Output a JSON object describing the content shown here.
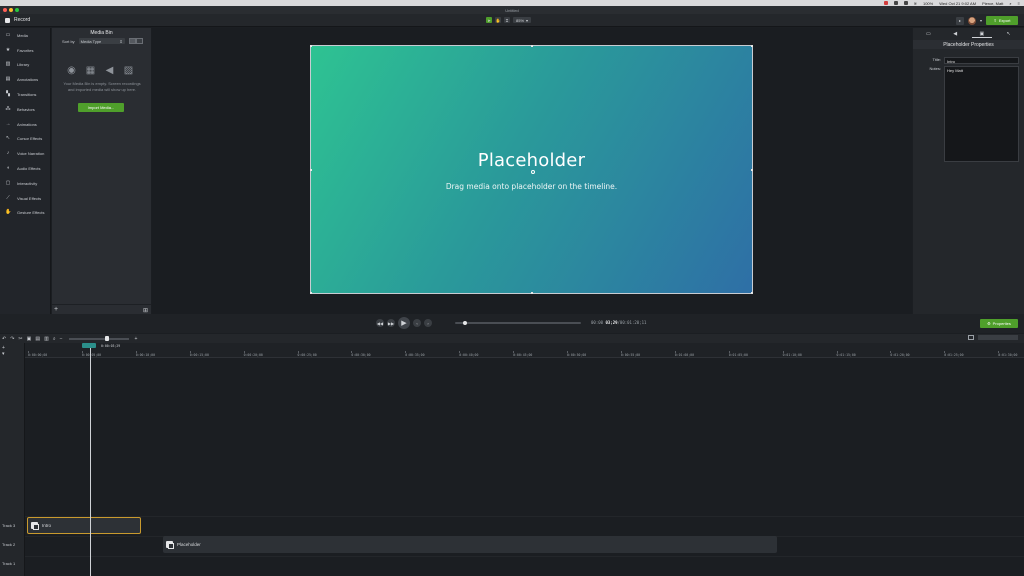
{
  "menubar": {
    "battery": "100%",
    "datetime": "Wed Oct 21  9:02 AM",
    "user": "Pierce, Matt"
  },
  "window": {
    "title": "Untitled"
  },
  "toolbar": {
    "record_label": "Record",
    "zoom_value": "85%",
    "export_label": "Export"
  },
  "sidebar": {
    "items": [
      {
        "label": "Media",
        "icon": "media-icon"
      },
      {
        "label": "Favorites",
        "icon": "star-icon"
      },
      {
        "label": "Library",
        "icon": "library-icon"
      },
      {
        "label": "Annotations",
        "icon": "annotations-icon"
      },
      {
        "label": "Transitions",
        "icon": "transitions-icon"
      },
      {
        "label": "Behaviors",
        "icon": "behaviors-icon"
      },
      {
        "label": "Animations",
        "icon": "animations-icon"
      },
      {
        "label": "Cursor Effects",
        "icon": "cursor-icon"
      },
      {
        "label": "Voice Narration",
        "icon": "microphone-icon"
      },
      {
        "label": "Audio Effects",
        "icon": "audio-icon"
      },
      {
        "label": "Interactivity",
        "icon": "interactivity-icon"
      },
      {
        "label": "Visual Effects",
        "icon": "wand-icon"
      },
      {
        "label": "Gesture Effects",
        "icon": "hand-icon"
      }
    ]
  },
  "media_bin": {
    "title": "Media Bin",
    "sort_label": "Sort by",
    "sort_value": "Media Type",
    "empty_text": "Your Media Bin is empty. Screen recordings and imported media will show up here.",
    "import_label": "Import Media..."
  },
  "canvas": {
    "placeholder_title": "Placeholder",
    "placeholder_subtitle": "Drag media onto placeholder on the timeline."
  },
  "properties": {
    "panel_title": "Placeholder Properties",
    "title_label": "Title:",
    "title_value": "Intro",
    "notes_label": "Notes:",
    "notes_value": "Hey Matt"
  },
  "playback": {
    "time_prefix": "00:00",
    "time_current": "03;29",
    "time_total": "/00:01:20;11",
    "properties_label": "Properties"
  },
  "timeline": {
    "playhead_time": "0:00:03;29",
    "ruler_ticks": [
      "0:00:00;00",
      "0:00:05;00",
      "0:00:10;00",
      "0:00:15;00",
      "0:00:20;00",
      "0:00:25;00",
      "0:00:30;00",
      "0:00:35;00",
      "0:00:40;00",
      "0:00:45;00",
      "0:00:50;00",
      "0:00:55;00",
      "0:01:00;00",
      "0:01:05;00",
      "0:01:10;00",
      "0:01:15;00",
      "0:01:20;00",
      "0:01:25;00",
      "0:01:30;00"
    ],
    "tracks": [
      {
        "label": "Track 3"
      },
      {
        "label": "Track 2"
      },
      {
        "label": "Track 1"
      }
    ],
    "clips": [
      {
        "label": "Intro"
      },
      {
        "label": "Placeholder"
      }
    ]
  }
}
